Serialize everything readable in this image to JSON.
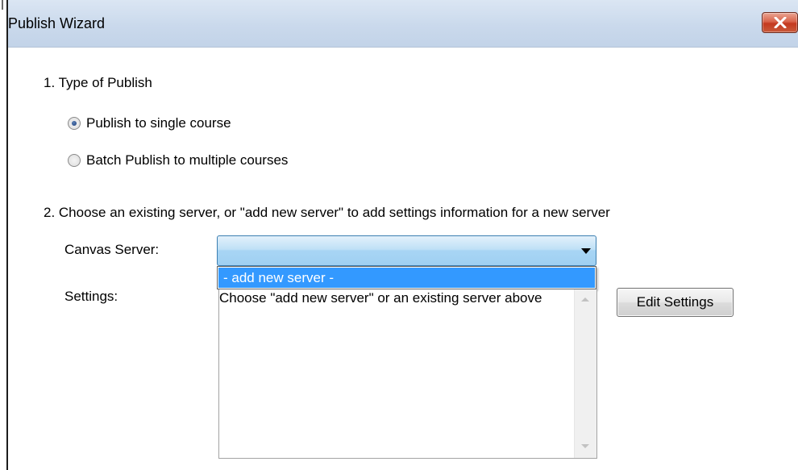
{
  "window": {
    "title": "Publish Wizard",
    "close_icon": "close-icon"
  },
  "section1": {
    "heading": "1.  Type of Publish",
    "options": [
      {
        "label": "Publish to single course",
        "checked": true
      },
      {
        "label": "Batch Publish to multiple courses",
        "checked": false
      }
    ]
  },
  "section2": {
    "heading": "2.  Choose an existing server, or \"add new server\" to add settings information for a new server",
    "server_label": "Canvas Server:",
    "server_value": "",
    "dropdown_options": [
      "- add new server -"
    ],
    "settings_label": "Settings:",
    "settings_text": "Choose \"add new server\" or an existing server above",
    "edit_button": "Edit Settings"
  },
  "colors": {
    "selection": "#3399ff",
    "titlebar": "#cad9ec",
    "close_button": "#c4391f"
  }
}
